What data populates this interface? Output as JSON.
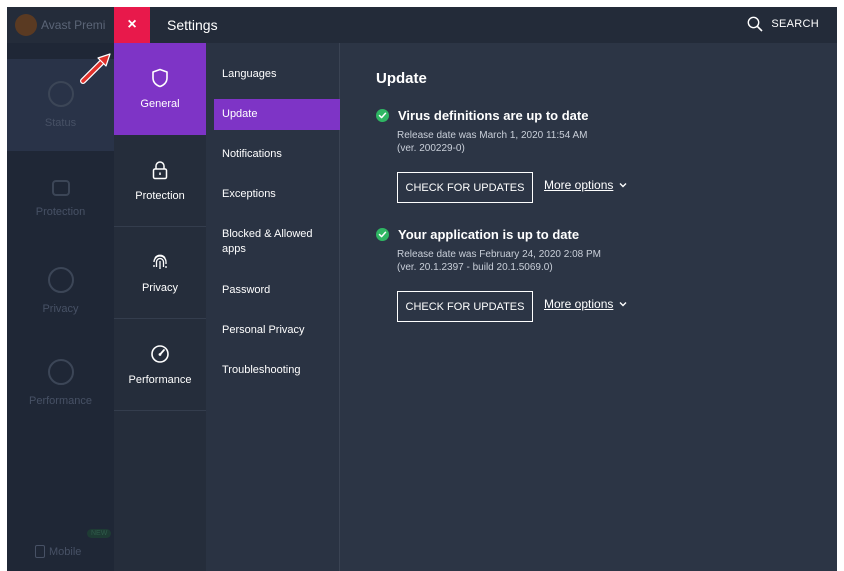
{
  "background_app": {
    "title": "Avast Premi",
    "nav": [
      "Status",
      "Protection",
      "Privacy",
      "Performance"
    ],
    "mobile_label": "Mobile",
    "new_badge": "NEW"
  },
  "topbar": {
    "close_label": "×",
    "title": "Settings",
    "search_label": "SEARCH"
  },
  "categories": [
    {
      "label": "General",
      "icon": "shield-icon",
      "active": true
    },
    {
      "label": "Protection",
      "icon": "lock-icon",
      "active": false
    },
    {
      "label": "Privacy",
      "icon": "fingerprint-icon",
      "active": false
    },
    {
      "label": "Performance",
      "icon": "speedometer-icon",
      "active": false
    }
  ],
  "submenu": [
    {
      "label": "Languages"
    },
    {
      "label": "Update",
      "active": true
    },
    {
      "label": "Notifications"
    },
    {
      "label": "Exceptions"
    },
    {
      "label": "Blocked & Allowed apps"
    },
    {
      "label": "Password"
    },
    {
      "label": "Personal Privacy"
    },
    {
      "label": "Troubleshooting"
    }
  ],
  "content": {
    "heading": "Update",
    "virus": {
      "title": "Virus definitions are up to date",
      "release": "Release date was March 1, 2020 11:54 AM",
      "version": "(ver. 200229-0)",
      "button": "CHECK FOR UPDATES",
      "more": "More options"
    },
    "app": {
      "title": "Your application is up to date",
      "release": "Release date was February 24, 2020 2:08 PM",
      "version": "(ver. 20.1.2397 - build 20.1.5069.0)",
      "button": "CHECK FOR UPDATES",
      "more": "More options"
    }
  },
  "colors": {
    "accent": "#7e34c6",
    "close": "#e8194b",
    "success": "#2fb663",
    "background": "#2c3545"
  }
}
